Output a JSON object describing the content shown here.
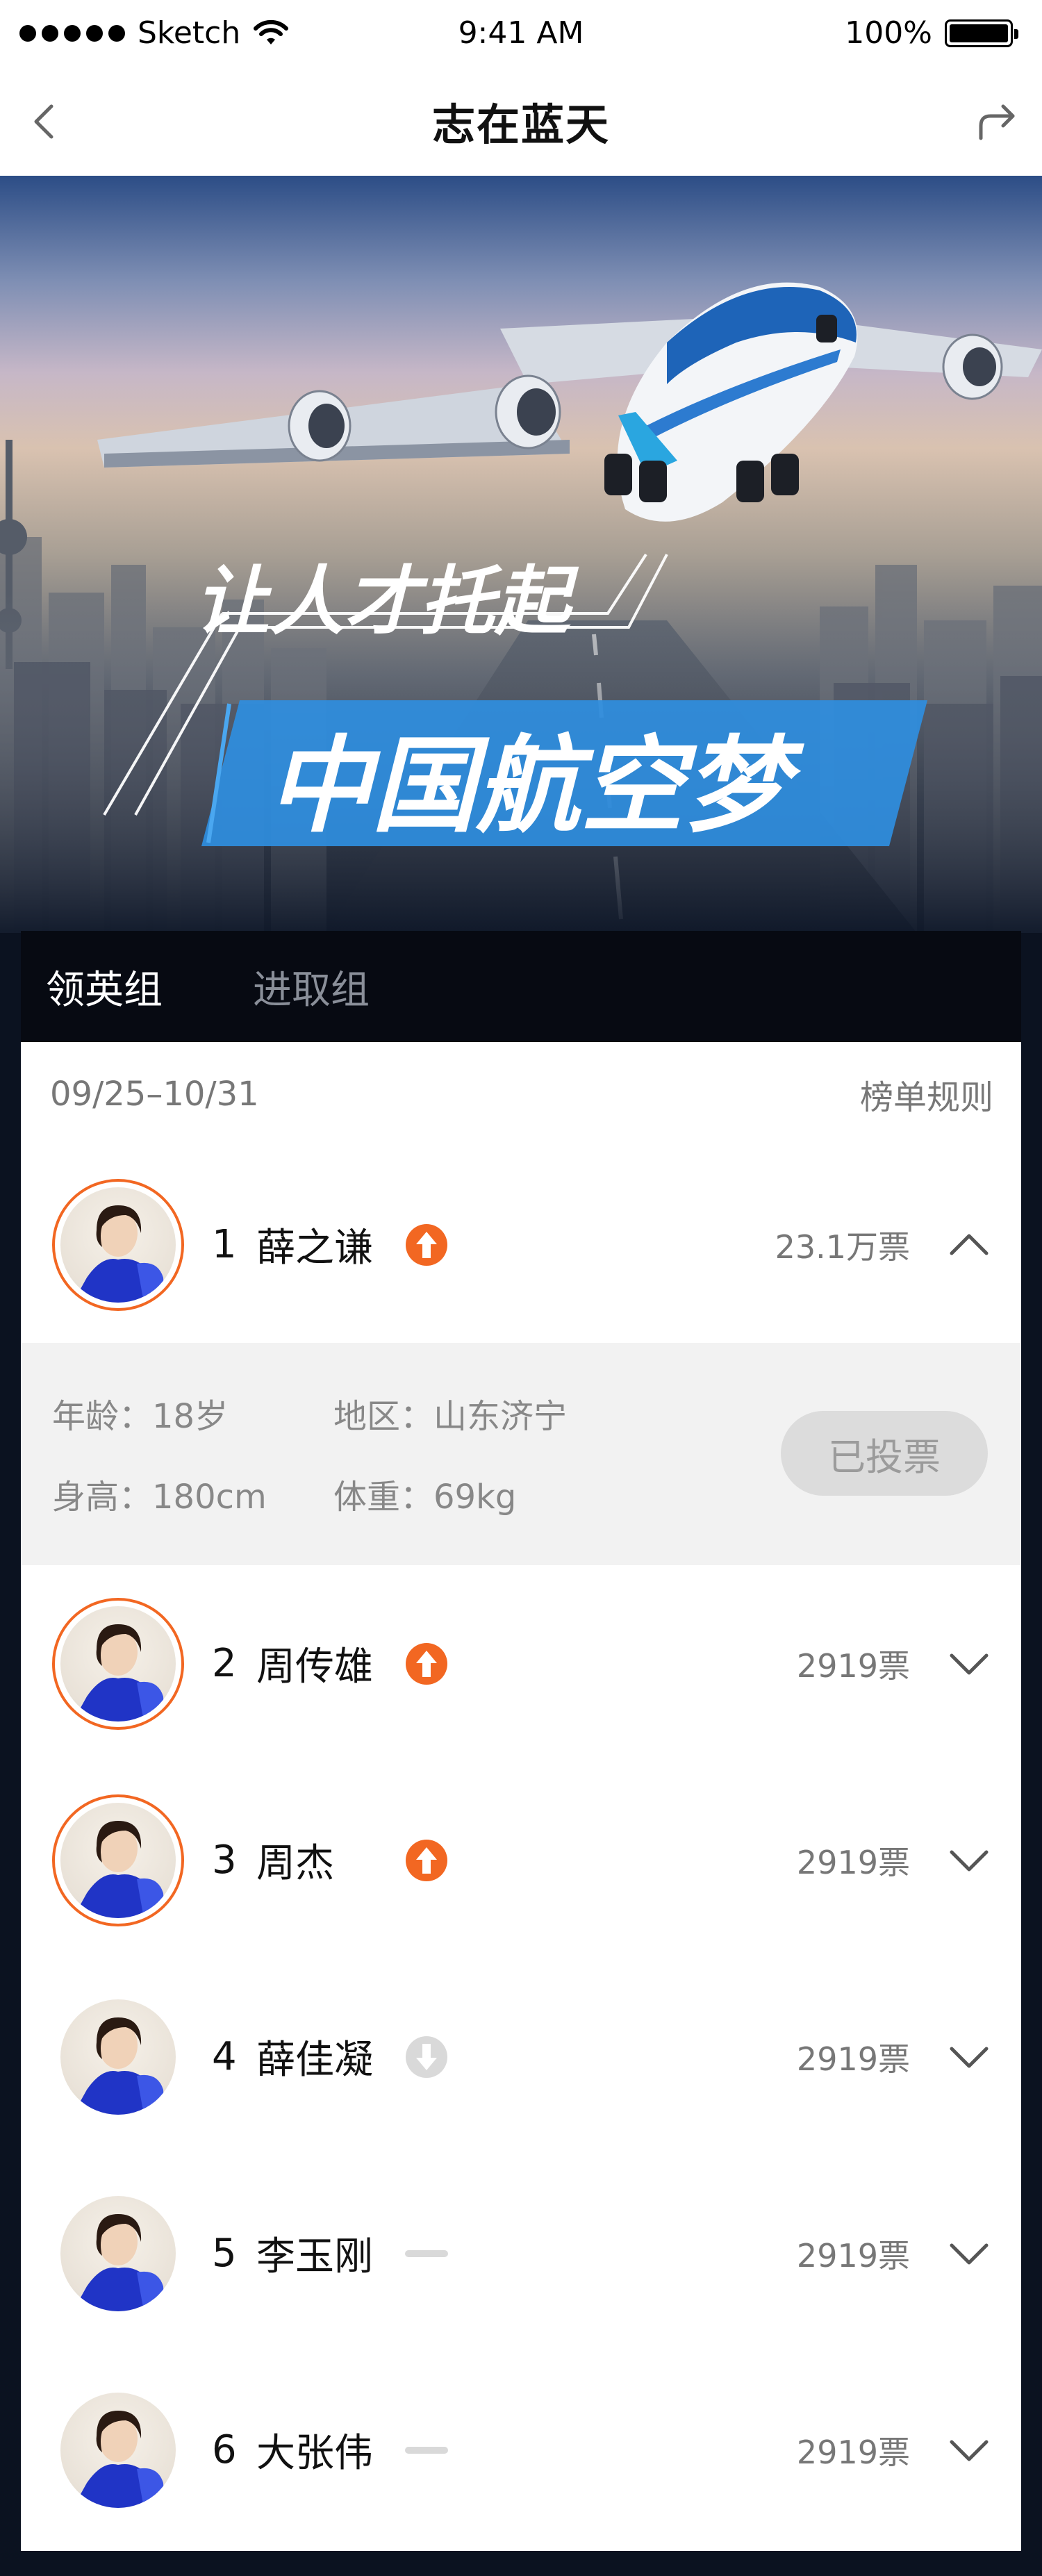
{
  "status_bar": {
    "carrier": "Sketch",
    "time": "9:41 AM",
    "battery": "100%"
  },
  "nav": {
    "title": "志在蓝天",
    "back_icon": "chevron-left-icon",
    "share_icon": "share-icon"
  },
  "banner": {
    "slogan_line1": "让人才托起",
    "slogan_line2": "中国航空梦"
  },
  "tabs": [
    {
      "label": "领英组",
      "active": true
    },
    {
      "label": "进取组",
      "active": false
    }
  ],
  "list_header": {
    "date_range": "09/25–10/31",
    "rules_link": "榜单规则"
  },
  "ranking": [
    {
      "rank": "1",
      "name": "薛之谦",
      "trend": "up",
      "votes": "23.1万票",
      "expanded": true,
      "ringed": true
    },
    {
      "rank": "2",
      "name": "周传雄",
      "trend": "up",
      "votes": "2919票",
      "expanded": false,
      "ringed": true
    },
    {
      "rank": "3",
      "name": "周杰",
      "trend": "up",
      "votes": "2919票",
      "expanded": false,
      "ringed": true
    },
    {
      "rank": "4",
      "name": "薛佳凝",
      "trend": "down",
      "votes": "2919票",
      "expanded": false,
      "ringed": false
    },
    {
      "rank": "5",
      "name": "李玉刚",
      "trend": "flat",
      "votes": "2919票",
      "expanded": false,
      "ringed": false
    },
    {
      "rank": "6",
      "name": "大张伟",
      "trend": "flat",
      "votes": "2919票",
      "expanded": false,
      "ringed": false
    }
  ],
  "detail": {
    "age": "年龄：18岁",
    "region": "地区：山东济宁",
    "height": "身高：180cm",
    "weight": "体重：69kg",
    "voted_button": "已投票"
  },
  "colors": {
    "accent": "#f26722",
    "trend_up": "#f26722",
    "trend_down": "#d9d9d9",
    "banner_blue": "#2f8ee0"
  }
}
